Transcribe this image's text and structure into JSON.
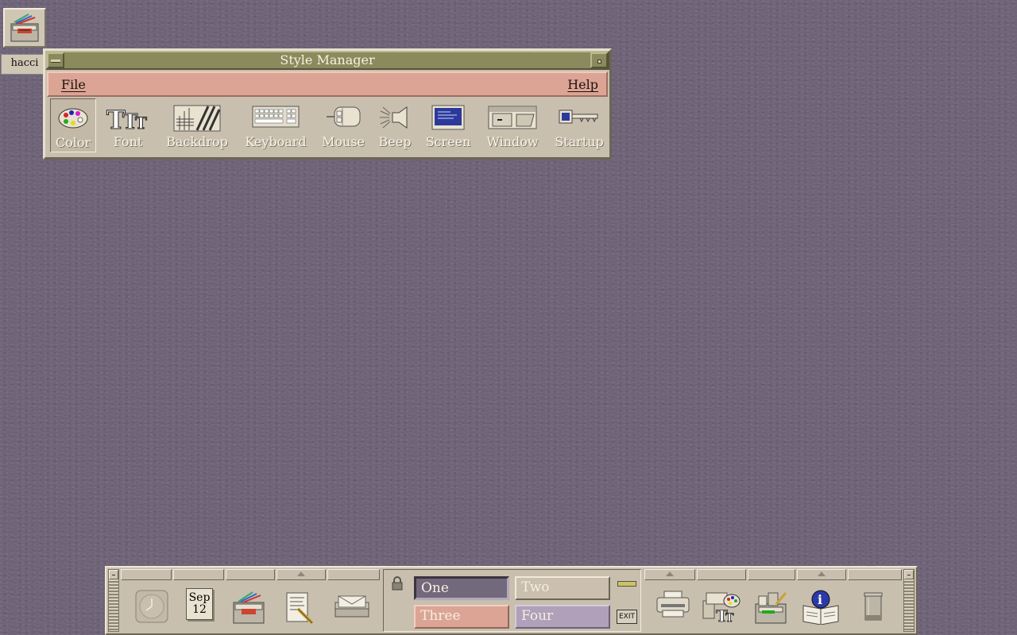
{
  "desktop": {
    "home_icon_label": "hacci"
  },
  "style_manager": {
    "title": "Style Manager",
    "menu": {
      "file": "File",
      "help": "Help"
    },
    "tools": [
      {
        "label": "Color",
        "icon": "palette-icon"
      },
      {
        "label": "Font",
        "icon": "font-icon"
      },
      {
        "label": "Backdrop",
        "icon": "backdrop-icon"
      },
      {
        "label": "Keyboard",
        "icon": "keyboard-icon"
      },
      {
        "label": "Mouse",
        "icon": "mouse-icon"
      },
      {
        "label": "Beep",
        "icon": "speaker-icon"
      },
      {
        "label": "Screen",
        "icon": "screen-icon"
      },
      {
        "label": "Window",
        "icon": "window-icon"
      },
      {
        "label": "Startup",
        "icon": "key-icon"
      }
    ]
  },
  "front_panel": {
    "calendar": {
      "month": "Sep",
      "day": "12"
    },
    "workspaces": {
      "one": "One",
      "two": "Two",
      "three": "Three",
      "four": "Four"
    },
    "exit_label": "EXIT"
  }
}
